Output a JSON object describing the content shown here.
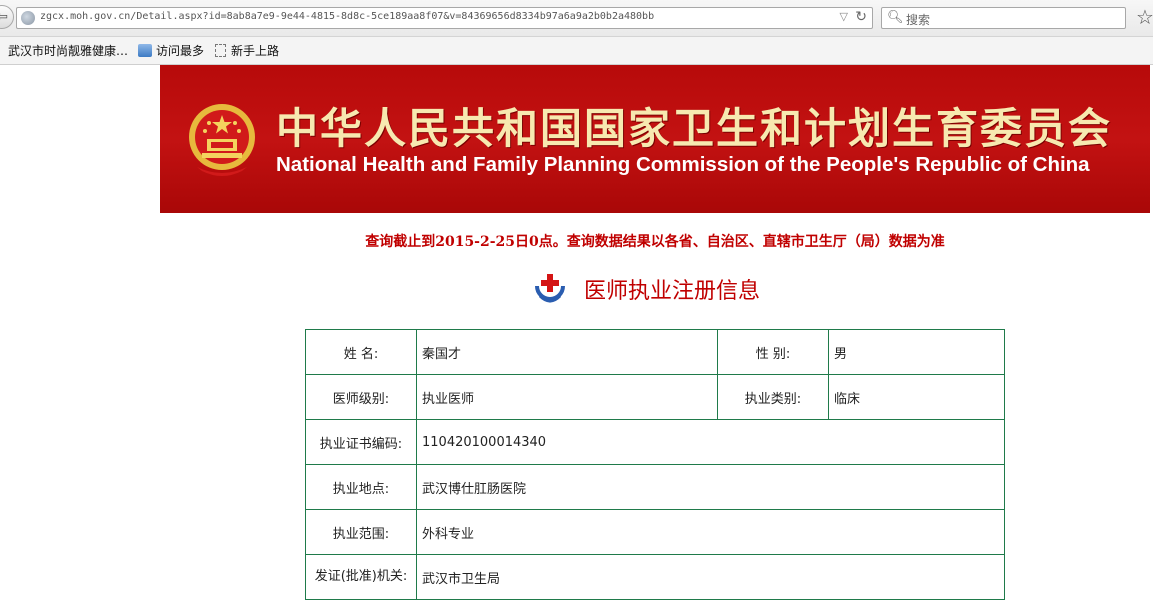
{
  "browser": {
    "url": "zgcx.moh.gov.cn/Detail.aspx?id=8ab8a7e9-9e44-4815-8d8c-5ce189aa8f07&v=84369656d8334b97a6a9a2b0b2a480bb",
    "search_placeholder": "搜索",
    "bookmarks": [
      {
        "label": "武汉市时尚靓雅健康…"
      },
      {
        "label": "访问最多"
      },
      {
        "label": "新手上路"
      }
    ]
  },
  "banner": {
    "title_cn": "中华人民共和国国家卫生和计划生育委员会",
    "title_en": "National Health and Family Planning Commission of the People's Republic of China"
  },
  "notice": "查询截止到2015-2-25日0点。查询数据结果以各省、自治区、直辖市卫生厅（局）数据为准",
  "section_title": "医师执业注册信息",
  "record": {
    "name_label": "姓 名:",
    "name_value": "秦国才",
    "gender_label": "性 别:",
    "gender_value": "男",
    "level_label": "医师级别:",
    "level_value": "执业医师",
    "category_label": "执业类别:",
    "category_value": "临床",
    "cert_label": "执业证书编码:",
    "cert_value": "110420100014340",
    "location_label": "执业地点:",
    "location_value": "武汉博仕肛肠医院",
    "scope_label": "执业范围:",
    "scope_value": "外科专业",
    "issuer_label": "发证(批准)机关:",
    "issuer_value": "武汉市卫生局"
  },
  "colors": {
    "banner_red": "#b70a0a",
    "notice_red": "#c00000",
    "table_border": "#1f7a4a"
  }
}
